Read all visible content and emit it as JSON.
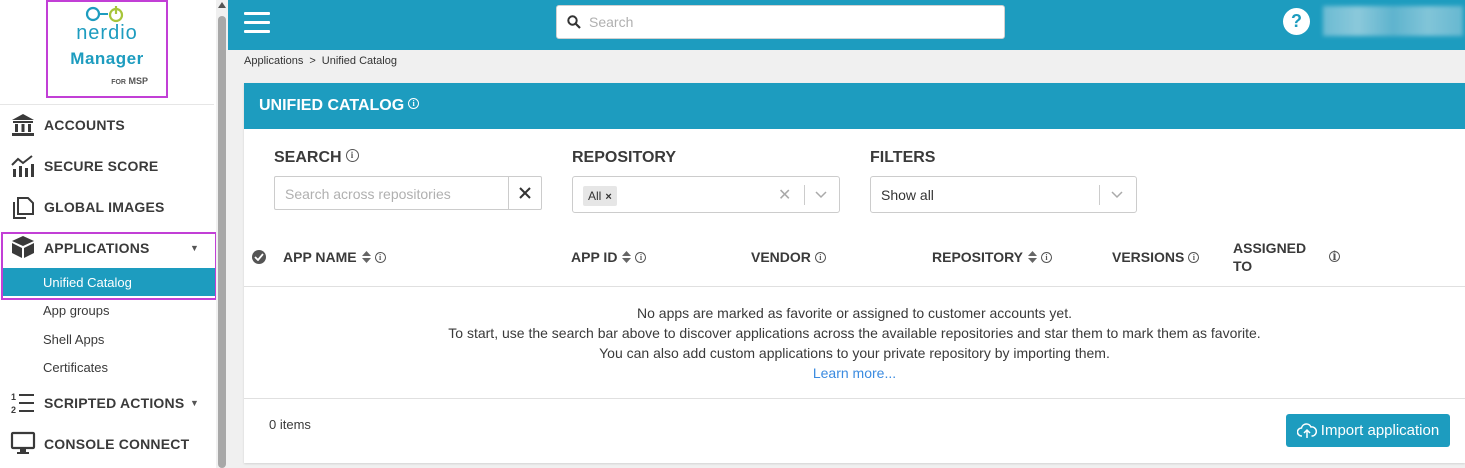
{
  "logo": {
    "brand": "nerdio",
    "product": "Manager",
    "for_label": "FOR",
    "msp_label": "MSP"
  },
  "sidebar": {
    "items": [
      {
        "label": "ACCOUNTS",
        "icon": "bank-icon"
      },
      {
        "label": "SECURE SCORE",
        "icon": "chart-icon"
      },
      {
        "label": "GLOBAL IMAGES",
        "icon": "copy-icon"
      },
      {
        "label": "APPLICATIONS",
        "icon": "box-icon",
        "expanded": true
      },
      {
        "label": "SCRIPTED ACTIONS",
        "icon": "numbered-list-icon"
      },
      {
        "label": "CONSOLE CONNECT",
        "icon": "monitor-icon"
      }
    ],
    "sub_items": [
      {
        "label": "Unified Catalog",
        "active": true
      },
      {
        "label": "App groups"
      },
      {
        "label": "Shell Apps"
      },
      {
        "label": "Certificates"
      }
    ]
  },
  "topbar": {
    "search_placeholder": "Search",
    "help_label": "?"
  },
  "breadcrumb": {
    "parent": "Applications",
    "separator": ">",
    "current": "Unified Catalog"
  },
  "card": {
    "title": "UNIFIED CATALOG",
    "info": "i"
  },
  "filters": {
    "search_label": "SEARCH",
    "search_placeholder": "Search across repositories",
    "repository_label": "REPOSITORY",
    "repository_chip": "All",
    "filters_label": "FILTERS",
    "filters_value": "Show all"
  },
  "table": {
    "columns": [
      {
        "label": "APP NAME",
        "sortable": true
      },
      {
        "label": "APP ID",
        "sortable": true
      },
      {
        "label": "VENDOR",
        "sortable": false
      },
      {
        "label": "REPOSITORY",
        "sortable": true
      },
      {
        "label": "VERSIONS",
        "sortable": false
      },
      {
        "label": "ASSIGNED",
        "label2": "TO",
        "sortable": false
      }
    ],
    "empty_lines": [
      "No apps are marked as favorite or assigned to customer accounts yet.",
      "To start, use the search bar above to discover applications across the available repositories and star them to mark them as favorite.",
      "You can also add custom applications to your private repository by importing them."
    ],
    "learn_more": "Learn more..."
  },
  "footer": {
    "item_count": "0 items",
    "import_button": "Import application"
  },
  "colors": {
    "accent": "#1d9cbf",
    "highlight": "#c23fd6",
    "link": "#3b8be0"
  }
}
